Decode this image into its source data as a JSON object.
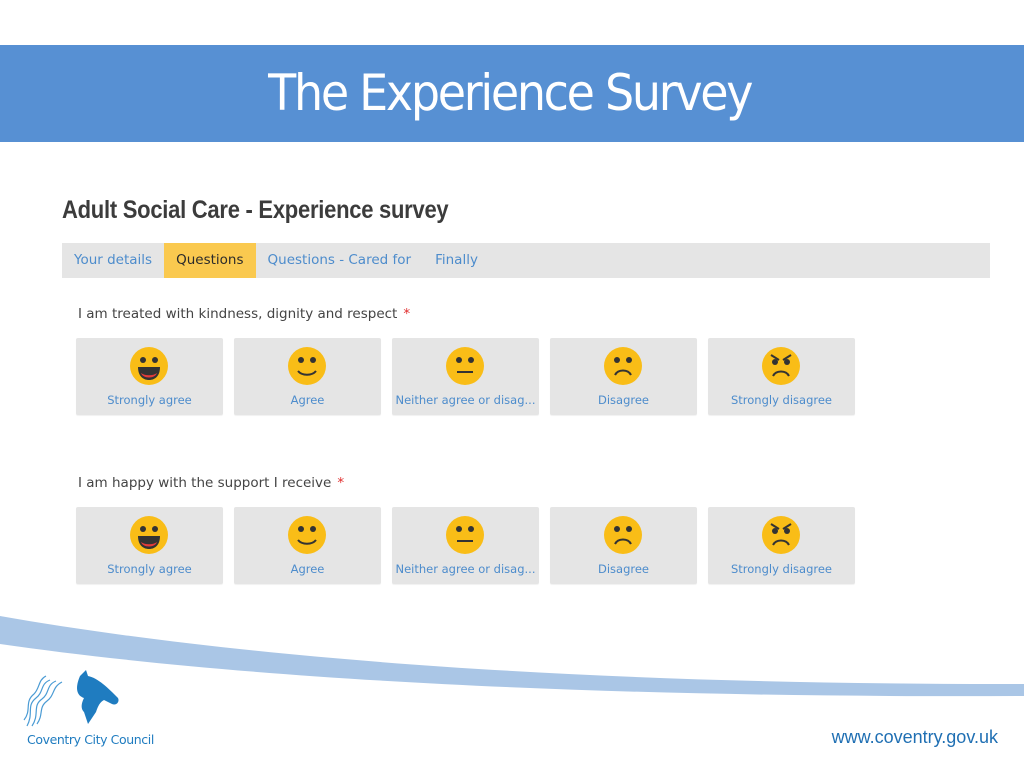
{
  "slide": {
    "title": "The Experience Survey",
    "banner_color": "#5790d3"
  },
  "form": {
    "title": "Adult Social Care - Experience survey",
    "tabs": [
      {
        "label": "Your details",
        "active": false
      },
      {
        "label": "Questions",
        "active": true
      },
      {
        "label": "Questions - Cared for",
        "active": false
      },
      {
        "label": "Finally",
        "active": false
      }
    ],
    "active_tab_color": "#fac94f",
    "required_marker": "*",
    "questions": [
      {
        "text": "I am treated with kindness, dignity and respect",
        "required": true,
        "options": [
          {
            "label": "Strongly agree",
            "icon": "grinning-face-icon"
          },
          {
            "label": "Agree",
            "icon": "smiling-face-icon"
          },
          {
            "label": "Neither agree or disag...",
            "icon": "neutral-face-icon"
          },
          {
            "label": "Disagree",
            "icon": "frowning-face-icon"
          },
          {
            "label": "Strongly disagree",
            "icon": "angry-face-icon"
          }
        ]
      },
      {
        "text": "I am happy with the support I receive",
        "required": true,
        "options": [
          {
            "label": "Strongly agree",
            "icon": "grinning-face-icon"
          },
          {
            "label": "Agree",
            "icon": "smiling-face-icon"
          },
          {
            "label": "Neither agree or disag...",
            "icon": "neutral-face-icon"
          },
          {
            "label": "Disagree",
            "icon": "frowning-face-icon"
          },
          {
            "label": "Strongly disagree",
            "icon": "angry-face-icon"
          }
        ]
      }
    ]
  },
  "footer": {
    "org_name": "Coventry City Council",
    "website": "www.coventry.gov.uk"
  }
}
